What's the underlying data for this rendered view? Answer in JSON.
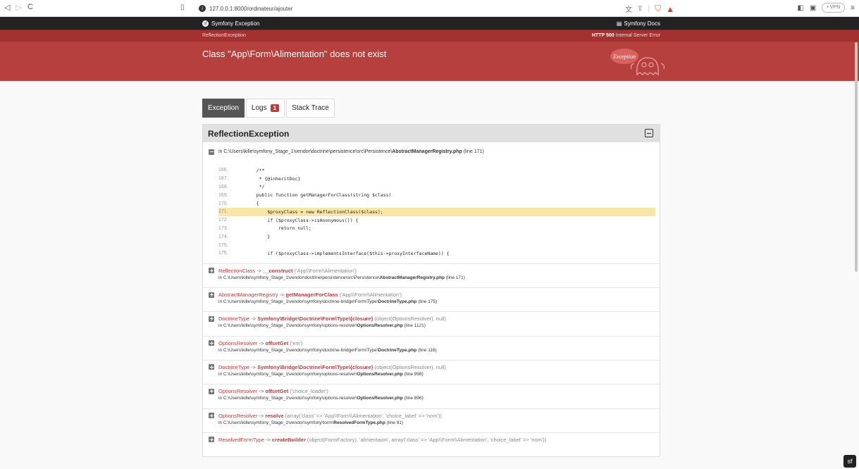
{
  "browser": {
    "url_text": "127.0.0.1:8000/ordinateur/ajouter",
    "info_glyph": "i",
    "vpn_label": "• VPN"
  },
  "topbar": {
    "left_label": "Symfony Exception",
    "right_label": "Symfony Docs"
  },
  "subbar": {
    "left_label": "ReflectionException",
    "status_code": "HTTP 500",
    "status_text": "Internal Server Error"
  },
  "header": {
    "message": "Class \"App\\Form\\Alimentation\" does not exist",
    "ghost_label": "Exception"
  },
  "tabs": [
    {
      "label": "Exception",
      "active": true
    },
    {
      "label": "Logs",
      "badge": "1"
    },
    {
      "label": "Stack Trace"
    }
  ],
  "panel": {
    "title": "ReflectionException",
    "location_prefix": "in C:\\Users\\kille\\symfony_Stage_1\\vendor\\doctrine\\persistence\\src\\Persistence\\",
    "location_file": "AbstractManagerRegistry.php",
    "location_line": "(line 171)"
  },
  "code_lines": [
    {
      "n": "166.",
      "code": "    /**",
      "cls": "cm"
    },
    {
      "n": "167.",
      "code": "     * {@inheritDoc}",
      "cls": "cm"
    },
    {
      "n": "168.",
      "code": "     */",
      "cls": "cm"
    },
    {
      "n": "169.",
      "code": "    public function getManagerForClass(string $class)",
      "cls": ""
    },
    {
      "n": "170.",
      "code": "    {",
      "cls": ""
    },
    {
      "n": "171.",
      "code": "        $proxyClass = new ReflectionClass($class);",
      "cls": "",
      "hl": true
    },
    {
      "n": "172.",
      "code": "        if ($proxyClass->isAnonymous()) {",
      "cls": ""
    },
    {
      "n": "173.",
      "code": "            return null;",
      "cls": ""
    },
    {
      "n": "174.",
      "code": "        }",
      "cls": ""
    },
    {
      "n": "175.",
      "code": "",
      "cls": ""
    },
    {
      "n": "176.",
      "code": "        if ($proxyClass->implementsInterface($this->proxyInterfaceName)) {",
      "cls": ""
    }
  ],
  "frames": [
    {
      "cls": "ReflectionClass",
      "fn": "__construct",
      "args": "('App\\\\Form\\\\Alimentation')",
      "path": "in C:\\Users\\kille\\symfony_Stage_1\\vendor\\doctrine\\persistence\\src\\Persistence\\",
      "file": "AbstractManagerRegistry.php",
      "line": "(line 171)"
    },
    {
      "cls": "AbstractManagerRegistry",
      "fn": "getManagerForClass",
      "args": "('App\\\\Form\\\\Alimentation')",
      "path": "in C:\\Users\\kille\\symfony_Stage_1\\vendor\\symfony\\doctrine-bridge\\Form\\Type\\",
      "file": "DoctrineType.php",
      "line": "(line 175)"
    },
    {
      "cls": "DoctrineType",
      "fn": "Symfony\\Bridge\\Doctrine\\Form\\Type\\{closure}",
      "args": "(object(OptionsResolver), null)",
      "path": "in C:\\Users\\kille\\symfony_Stage_1\\vendor\\symfony\\options-resolver\\",
      "file": "OptionsResolver.php",
      "line": "(line 1121)"
    },
    {
      "cls": "OptionsResolver",
      "fn": "offsetGet",
      "args": "('em')",
      "path": "in C:\\Users\\kille\\symfony_Stage_1\\vendor\\symfony\\doctrine-bridge\\Form\\Type\\",
      "file": "DoctrineType.php",
      "line": "(line 116)"
    },
    {
      "cls": "DoctrineType",
      "fn": "Symfony\\Bridge\\Doctrine\\Form\\Type\\{closure}",
      "args": "(object(OptionsResolver), null)",
      "path": "in C:\\Users\\kille\\symfony_Stage_1\\vendor\\symfony\\options-resolver\\",
      "file": "OptionsResolver.php",
      "line": "(line 998)"
    },
    {
      "cls": "OptionsResolver",
      "fn": "offsetGet",
      "args": "('choice_loader')",
      "path": "in C:\\Users\\kille\\symfony_Stage_1\\vendor\\symfony\\options-resolver\\",
      "file": "OptionsResolver.php",
      "line": "(line 896)"
    },
    {
      "cls": "OptionsResolver",
      "fn": "resolve",
      "args": "(array('class' => 'App\\\\Form\\\\Alimentation', 'choice_label' => 'nom'))",
      "path": "in C:\\Users\\kille\\symfony_Stage_1\\vendor\\symfony\\form\\",
      "file": "ResolvedFormType.php",
      "line": "(line 91)"
    },
    {
      "cls": "ResolvedFormType",
      "fn": "createBuilder",
      "args": "(object(FormFactory), 'alimentaion', array('class' => 'App\\\\Form\\\\Alimentation', 'choice_label' => 'nom'))",
      "path": "",
      "file": "",
      "line": ""
    }
  ],
  "colors": {
    "accent": "#b5403d",
    "topbar": "#222222",
    "highlight": "#f9e6a4"
  }
}
